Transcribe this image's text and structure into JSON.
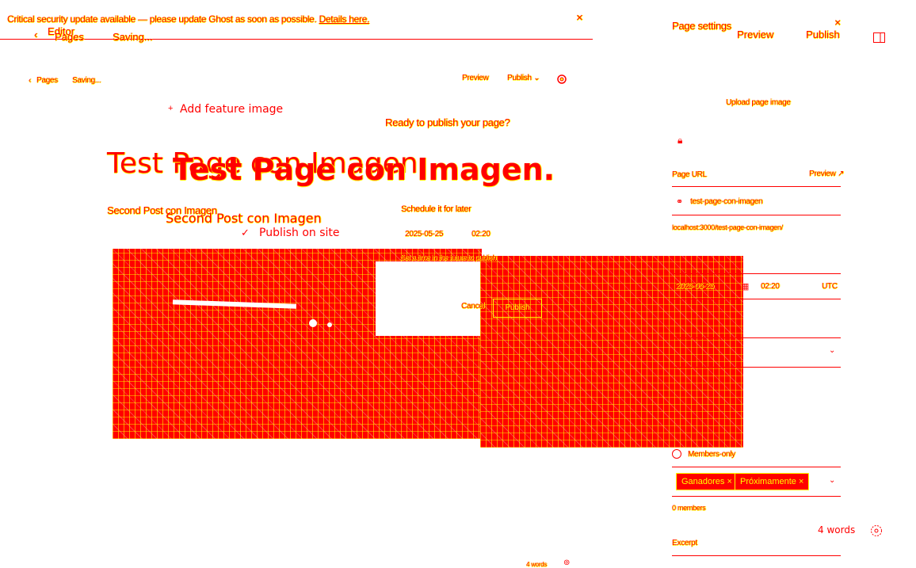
{
  "banner": {
    "text": "Critical security update available — please update Ghost as soon as possible.",
    "link": "Details here.",
    "close": "×"
  },
  "editor_header": {
    "back_label": "Editor",
    "crumb_pages": "Pages",
    "status": "Saving..."
  },
  "toolbar": {
    "crumb_pages": "Pages",
    "status": "Saving...",
    "preview": "Preview",
    "publish": "Publish",
    "publish_chevron": "⌄"
  },
  "feature_image": {
    "label": "Add feature image",
    "plus": "+"
  },
  "post": {
    "title_ghost": "Test Page con Imagen",
    "title_large": "Test Page con Imagen.",
    "subtitle_ghost": "Second Post con Imagen",
    "subtitle_large": "Second Post con Imagen",
    "publish_on_site": "Publish on site",
    "publish_check": "✓"
  },
  "publish_modal": {
    "heading": "Ready to publish your page?",
    "schedule_label": "Schedule it for later",
    "date": "2025-05-25",
    "time": "02:20",
    "future_note": "Set a time in the future to publish",
    "cancel": "Cancel",
    "confirm": "Publish"
  },
  "sidebar": {
    "title": "Page settings",
    "close": "×",
    "preview": "Preview",
    "publish": "Publish",
    "upload_label": "Upload page image",
    "page_url_label": "Page URL",
    "page_url_preview": "Preview",
    "slug": "test-page-con-imagen",
    "full_url": "localhost:3000/test-page-con-imagen/",
    "publish_date": "2025-05-25",
    "publish_time": "02:20",
    "timezone": "UTC",
    "access_option": "Members-only",
    "tags": [
      "Ganadores",
      "Próximamente"
    ],
    "members_count": "0 members",
    "excerpt_label": "Excerpt"
  },
  "footer": {
    "word_count": "4 words",
    "word_count_small": "4 words"
  },
  "colors": {
    "primary": "#ff0000",
    "secondary": "#ffff00",
    "background": "#ffffff"
  }
}
